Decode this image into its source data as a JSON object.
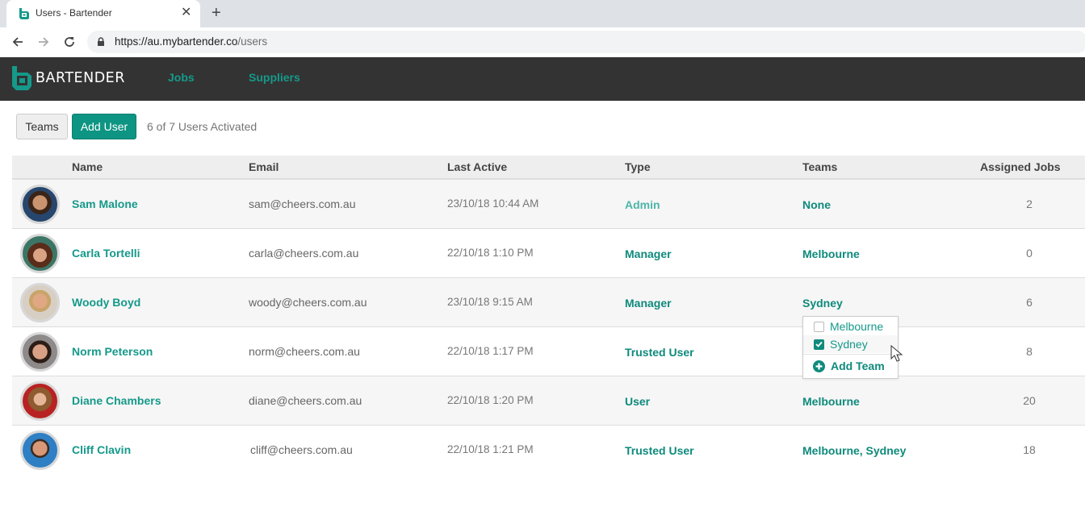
{
  "browser": {
    "tab_title": "Users - Bartender",
    "url_host": "https://au.mybartender.co",
    "url_path": "/users"
  },
  "app": {
    "brand": "BARTENDER",
    "nav": [
      {
        "label": "Jobs"
      },
      {
        "label": "Suppliers"
      }
    ],
    "accent_color": "#0e9483"
  },
  "actions": {
    "teams_label": "Teams",
    "add_user_label": "Add User",
    "activated_text": "6 of 7 Users Activated"
  },
  "table": {
    "columns": [
      "Name",
      "Email",
      "Last Active",
      "Type",
      "Teams",
      "Assigned Jobs"
    ],
    "rows": [
      {
        "name": "Sam Malone",
        "email": "sam@cheers.com.au",
        "last_active": "23/10/18 10:44 AM",
        "type": "Admin",
        "teams": "None",
        "jobs": "2"
      },
      {
        "name": "Carla Tortelli",
        "email": "carla@cheers.com.au",
        "last_active": "22/10/18 1:10 PM",
        "type": "Manager",
        "teams": "Melbourne",
        "jobs": "0"
      },
      {
        "name": "Woody Boyd",
        "email": "woody@cheers.com.au",
        "last_active": "23/10/18 9:15 AM",
        "type": "Manager",
        "teams": "Sydney",
        "jobs": "6"
      },
      {
        "name": "Norm Peterson",
        "email": "norm@cheers.com.au",
        "last_active": "22/10/18 1:17 PM",
        "type": "Trusted User",
        "teams": "",
        "jobs": "8"
      },
      {
        "name": "Diane Chambers",
        "email": "diane@cheers.com.au",
        "last_active": "22/10/18 1:20 PM",
        "type": "User",
        "teams": "Melbourne",
        "jobs": "20"
      },
      {
        "name": "Cliff Clavin",
        "email": "cliff@cheers.com.au",
        "last_active": "22/10/18 1:21 PM",
        "type": "Trusted User",
        "teams": "Melbourne, Sydney",
        "jobs": "18"
      }
    ]
  },
  "team_dropdown": {
    "options": [
      {
        "label": "Melbourne",
        "checked": false
      },
      {
        "label": "Sydney",
        "checked": true
      }
    ],
    "add_label": "Add Team"
  }
}
